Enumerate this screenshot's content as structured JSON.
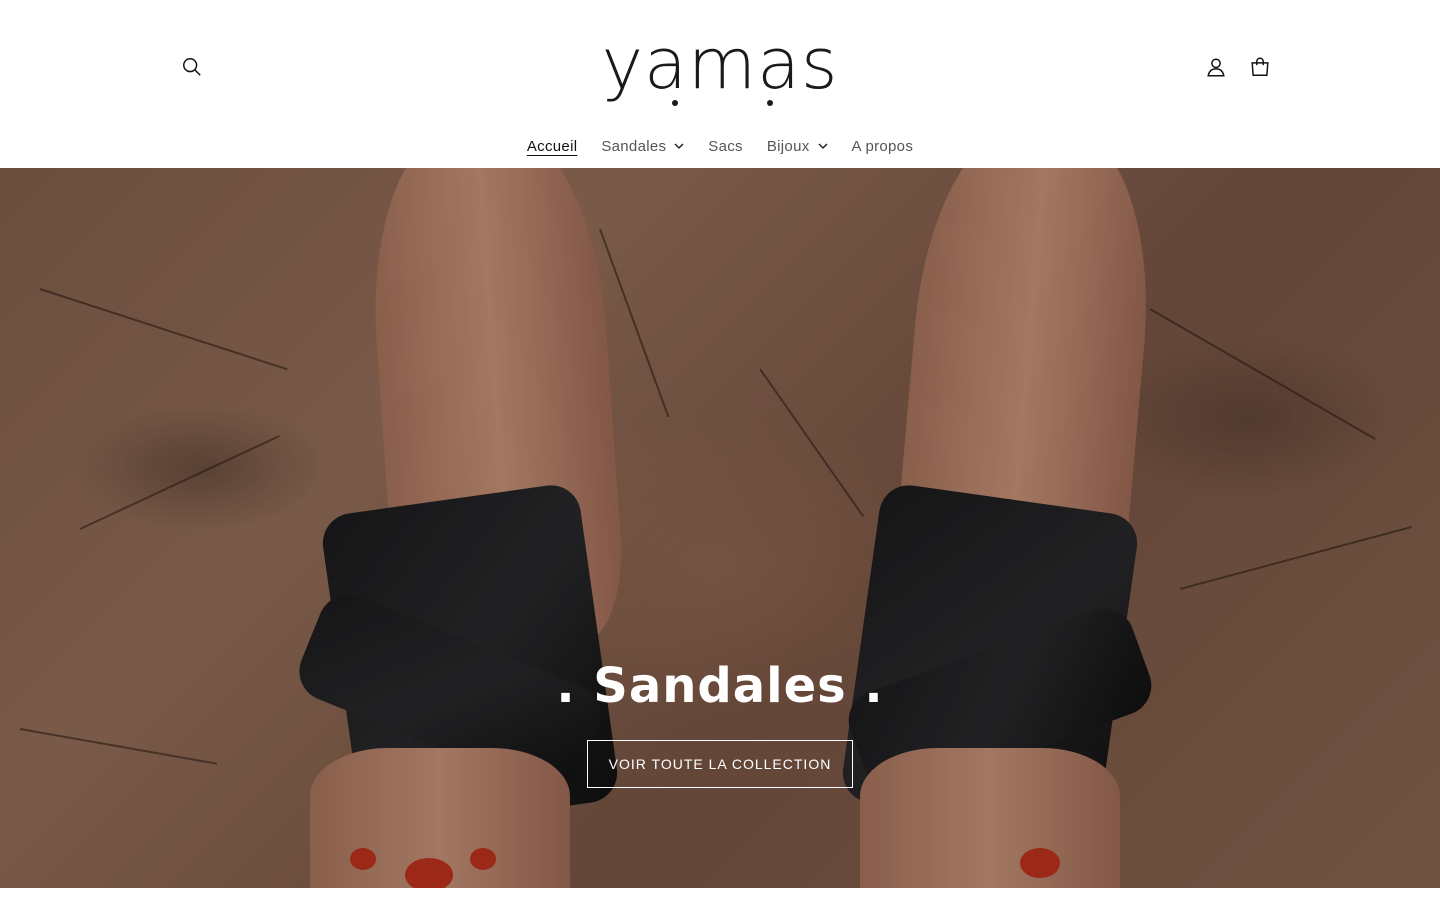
{
  "header": {
    "logo_text": "yamas",
    "search_label": "Recherche",
    "account_label": "Connexion",
    "cart_label": "Panier"
  },
  "nav": {
    "items": [
      {
        "label": "Accueil",
        "active": true,
        "dropdown": false
      },
      {
        "label": "Sandales",
        "active": false,
        "dropdown": true
      },
      {
        "label": "Sacs",
        "active": false,
        "dropdown": false
      },
      {
        "label": "Bijoux",
        "active": false,
        "dropdown": true
      },
      {
        "label": "A propos",
        "active": false,
        "dropdown": false
      }
    ]
  },
  "hero": {
    "title": ". Sandales .",
    "cta_label": "VOIR TOUTE LA COLLECTION"
  },
  "icons": {
    "search": "search-icon",
    "account": "user-icon",
    "cart": "shopping-bag-icon",
    "chevron": "chevron-down-icon"
  },
  "colors": {
    "text": "#121212",
    "nav_text": "#555555",
    "hero_text": "#ffffff",
    "toenail": "#c8341f",
    "sandal": "#1c1c1e"
  }
}
